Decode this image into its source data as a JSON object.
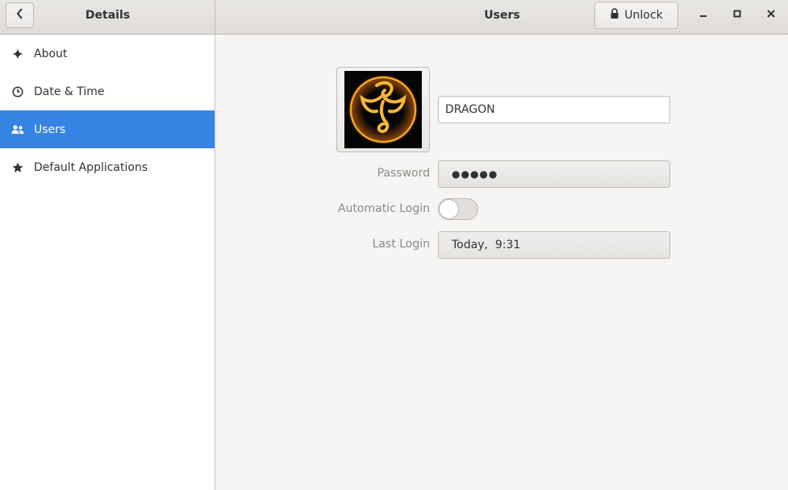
{
  "header": {
    "left_title": "Details",
    "right_title": "Users",
    "unlock_label": "Unlock"
  },
  "sidebar": {
    "items": [
      {
        "label": "About",
        "icon": "sparkle-icon"
      },
      {
        "label": "Date & Time",
        "icon": "clock-icon"
      },
      {
        "label": "Users",
        "icon": "users-icon",
        "selected": true
      },
      {
        "label": "Default Applications",
        "icon": "star-icon"
      }
    ]
  },
  "user": {
    "name": "DRAGON",
    "password_label": "Password",
    "password_value": "●●●●●",
    "auto_login_label": "Automatic Login",
    "auto_login_on": false,
    "last_login_label": "Last Login",
    "last_login_value": "Today,  9:31"
  },
  "colors": {
    "accent": "#3584e4",
    "avatar_bg": "#050505",
    "avatar_glow": "#f5a623"
  }
}
